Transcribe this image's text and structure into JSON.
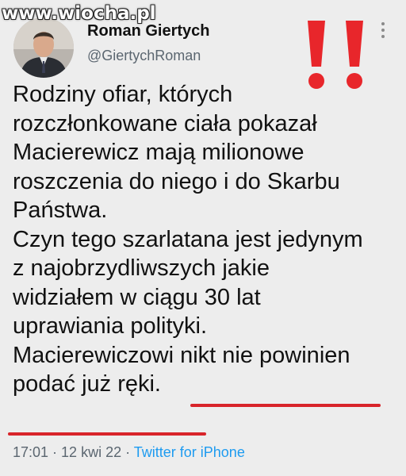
{
  "watermark": "www.wiocha.pl",
  "author": {
    "name": "Roman Giertych",
    "handle": "@GiertychRoman"
  },
  "tweet": {
    "text": "Rodziny ofiar, których\nrozczłonkowane ciała pokazał\nMacierewicz mają milionowe\nroszczenia do niego i do Skarbu\nPaństwa.\nCzyn tego szarlatana jest jedynym\nz najobrzydliwszych jakie\nwidziałem w ciągu 30 lat\nuprawiania polityki.\nMacierewiczowi nikt nie powinien\npodać już ręki."
  },
  "meta": {
    "time": "17:01",
    "separator": " · ",
    "date": "12 kwi 22",
    "separator2": " · ",
    "app": "Twitter for iPhone"
  },
  "colors": {
    "accent_red": "#d8242a",
    "link_blue": "#1d9bf0",
    "muted": "#5b6670"
  },
  "icons": [
    "more-options-icon",
    "double-exclamation-icon"
  ]
}
